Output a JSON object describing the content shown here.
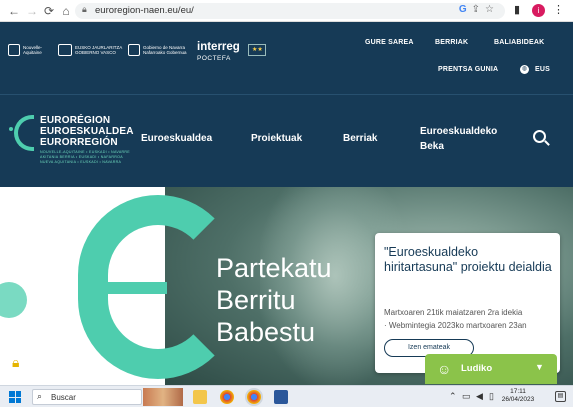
{
  "browser": {
    "url": "euroregion-naen.eu/eu/",
    "profile_initial": "i"
  },
  "top_bar": {
    "links": [
      "GURE SAREA",
      "BERRIAK",
      "BALIABIDEAK",
      "PRENTSA GUNIA"
    ],
    "language": "EUS",
    "partners": [
      {
        "name": "Nouvelle-Aquitaine",
        "lines": [
          "Nouvelle-",
          "Aquitaine"
        ]
      },
      {
        "name": "Eusko Jaurlaritza Gobierno Vasco",
        "lines": [
          "EUSKO JAURLARITZA",
          "GOBIERNO VASCO"
        ]
      },
      {
        "name": "Gobierno de Navarra Nafarroako Gobernua",
        "lines": [
          "Gobierno de Navarra",
          "Nafarroako Gobernua"
        ]
      }
    ],
    "interreg": "interreg",
    "poctefa": "POCTEFA"
  },
  "brand": {
    "lines": [
      "EURORÉGION",
      "EUROESKUALDEA",
      "EURORREGIÓN"
    ],
    "small_lines": [
      "NOUVELLE-AQUITAINE • EUSKADI • NAVARRE",
      "AKITANIA BERRIA • EUSKADI • NAFARROA",
      "NUEVA AQUITANIA • EUSKADI • NAVARRA"
    ]
  },
  "main_nav": {
    "items": [
      "Euroeskualdea",
      "Proiektuak",
      "Berriak",
      "Euroeskualdeko",
      "Beka"
    ]
  },
  "hero": {
    "lines": [
      "Partekatu",
      "Berritu",
      "Babestu"
    ]
  },
  "card": {
    "title": "\"Euroeskualdeko hiritartasuna\" proiektu deialdia",
    "desc_1": "Martxoaren 21tik maiatzaren 2ra idekia",
    "desc_2": "· Webmintegia 2023ko martxoaren 23an",
    "button": "Izen emateak"
  },
  "widget": {
    "label": "Ludiko"
  },
  "taskbar": {
    "search_label": "Buscar",
    "time": "17:11",
    "date": "26/04/2023"
  },
  "colors": {
    "navy": "#163a56",
    "mint": "#4ecdae",
    "ludiko_green": "#8bc34a"
  }
}
